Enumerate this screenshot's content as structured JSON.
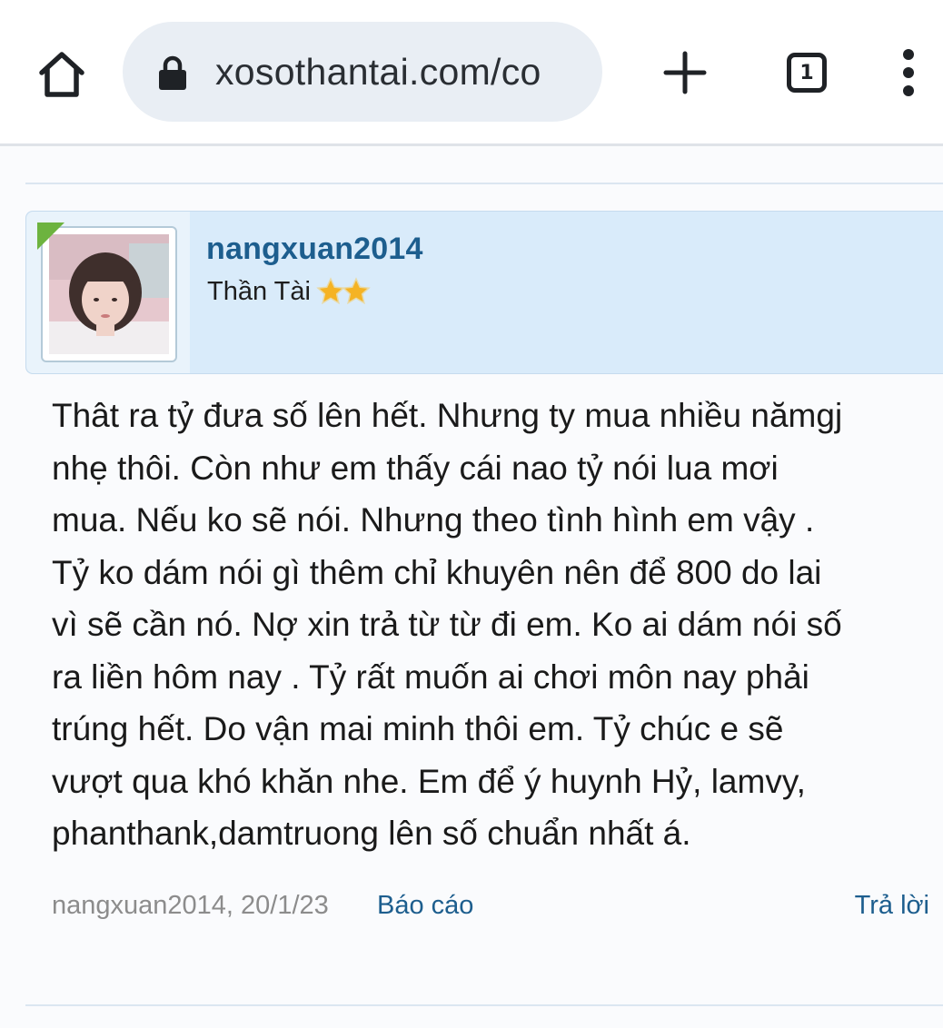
{
  "browser": {
    "url": "xosothantai.com/co",
    "tab_count": "1",
    "icons": {
      "home": "home-icon",
      "lock": "lock-icon",
      "new_tab": "plus-icon",
      "tabs": "tab-switcher-icon",
      "menu": "more-vert-icon"
    }
  },
  "post": {
    "username": "nangxuan2014",
    "user_title": "Thần Tài",
    "star_count": 2,
    "body_lines": [
      "Thât ra tỷ đưa số lên hết. Nhưng ty mua nhiều nămgj",
      "nhẹ thôi. Còn như em thấy cái nao tỷ nói lua mơi",
      "mua. Nếu ko sẽ nói. Nhưng theo tình hình em vậy .",
      "Tỷ ko dám nói gì thêm chỉ khuyên nên để 800 do lai",
      "vì sẽ cần nó. Nợ xin trả từ từ đi em. Ko ai dám nói số",
      "ra liền hôm nay . Tỷ rất muốn ai chơi môn nay phải",
      "trúng hết. Do vận mai minh thôi em. Tỷ chúc e sẽ",
      "vượt qua khó khăn nhe. Em để ý huynh Hỷ, lamvy,",
      "phanthank,damtruong lên số chuẩn nhất á."
    ],
    "meta": "nangxuan2014, 20/1/23",
    "report_label": "Báo cáo",
    "reply_label": "Trả lời"
  },
  "colors": {
    "header_bg": "#d9ebfa",
    "link": "#1d5e8e",
    "online": "#6db33f",
    "star": "#f5b324"
  }
}
